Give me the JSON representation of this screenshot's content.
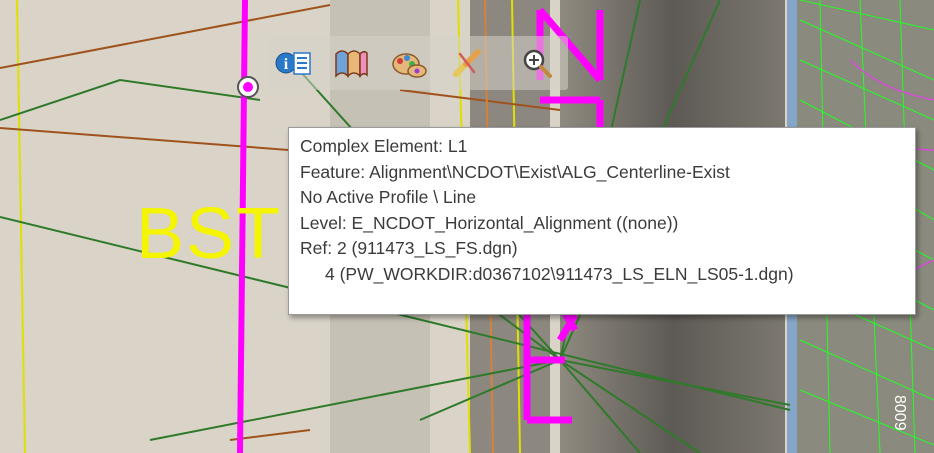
{
  "drawing": {
    "element_label": "BST",
    "colors": {
      "background": "#d9d4c7",
      "dark_pavement": "#6e6a63",
      "alignment_magenta": "#ff00ff",
      "tick_yellow": "#e0e000",
      "brown_line": "#a0521d",
      "green_line": "#2f7a2a",
      "bright_green": "#22ff22",
      "blue_border": "#86a6c9",
      "label_yellow": "#f5f500"
    }
  },
  "toolbar": {
    "buttons": [
      {
        "name": "element-info-icon",
        "title": "Element Information"
      },
      {
        "name": "properties-icon",
        "title": "Properties"
      },
      {
        "name": "palette-icon",
        "title": "Palette"
      },
      {
        "name": "link-icon",
        "title": "Link"
      },
      {
        "name": "zoom-icon",
        "title": "Zoom"
      }
    ]
  },
  "tooltip": {
    "line1": "Complex Element: L1",
    "line2": "Feature: Alignment\\NCDOT\\Exist\\ALG_Centerline-Exist",
    "line3": "No Active Profile \\ Line",
    "line4": "Level: E_NCDOT_Horizontal_Alignment ((none))",
    "line5": "Ref: 2 (911473_LS_FS.dgn)",
    "line6": "4 (PW_WORKDIR:d0367102\\911473_LS_ELN_LS05-1.dgn)"
  }
}
